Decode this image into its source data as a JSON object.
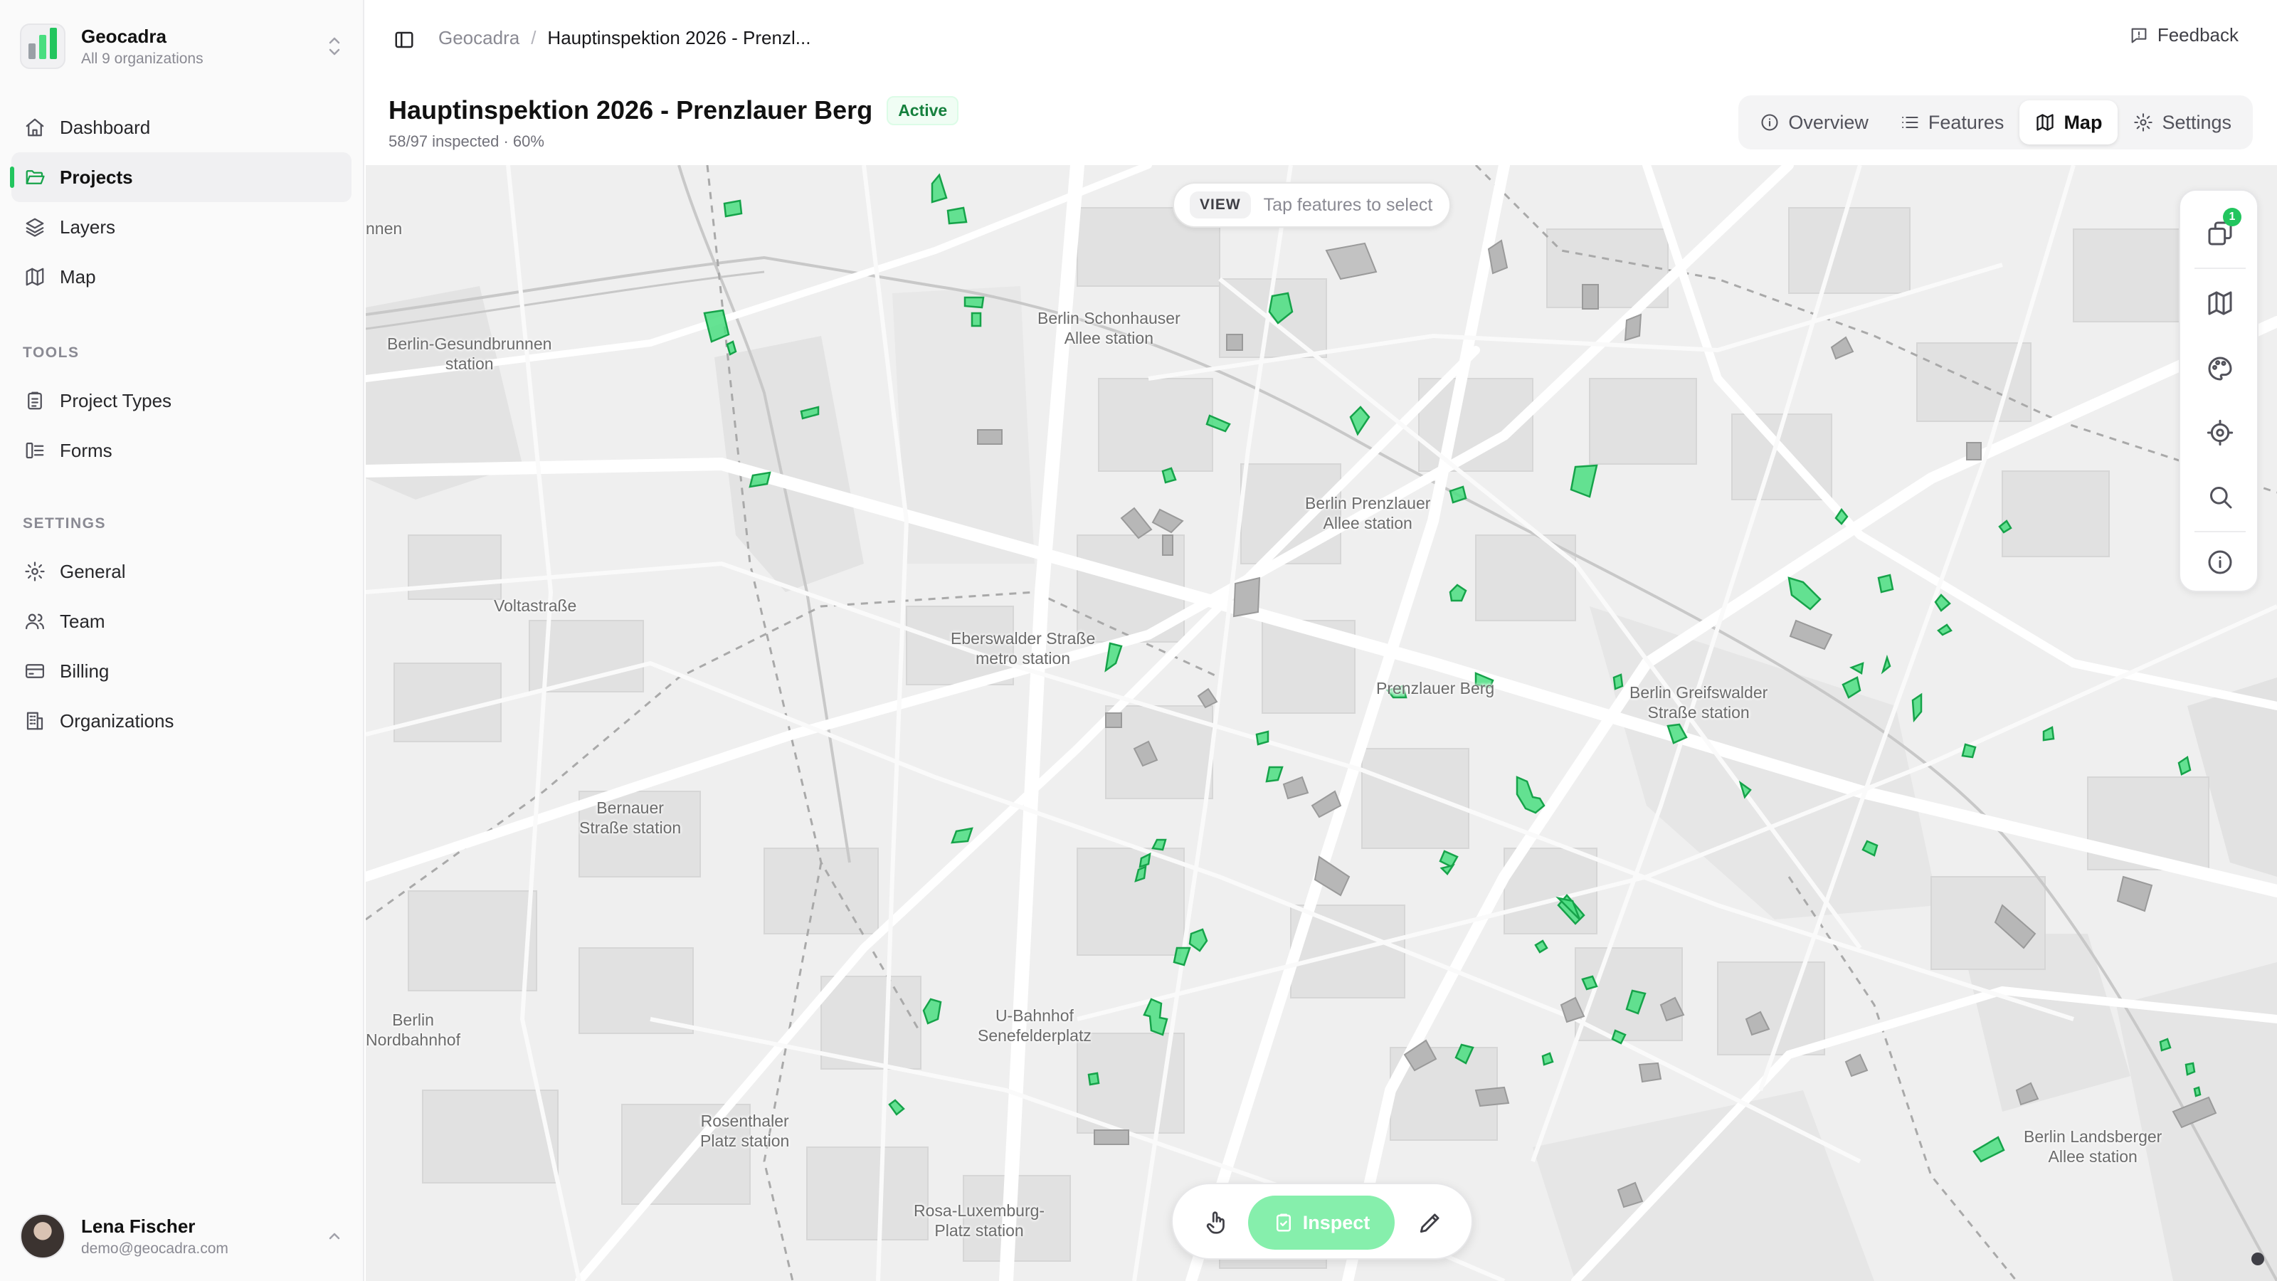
{
  "org": {
    "name": "Geocadra",
    "subtitle": "All 9 organizations"
  },
  "nav": {
    "main": [
      {
        "id": "dashboard",
        "label": "Dashboard",
        "icon": "home-icon"
      },
      {
        "id": "projects",
        "label": "Projects",
        "icon": "folder-open-icon",
        "active": true
      },
      {
        "id": "layers",
        "label": "Layers",
        "icon": "layers-icon"
      },
      {
        "id": "map",
        "label": "Map",
        "icon": "map-icon"
      }
    ],
    "tools_heading": "TOOLS",
    "tools": [
      {
        "id": "project-types",
        "label": "Project Types",
        "icon": "clipboard-list-icon"
      },
      {
        "id": "forms",
        "label": "Forms",
        "icon": "form-input-icon"
      }
    ],
    "settings_heading": "SETTINGS",
    "settings": [
      {
        "id": "general",
        "label": "General",
        "icon": "gear-icon"
      },
      {
        "id": "team",
        "label": "Team",
        "icon": "users-icon"
      },
      {
        "id": "billing",
        "label": "Billing",
        "icon": "credit-card-icon"
      },
      {
        "id": "organizations",
        "label": "Organizations",
        "icon": "building-icon"
      }
    ]
  },
  "user": {
    "name": "Lena Fischer",
    "email": "demo@geocadra.com"
  },
  "breadcrumb": {
    "root": "Geocadra",
    "separator": "/",
    "current": "Hauptinspektion 2026 - Prenzl..."
  },
  "feedback_label": "Feedback",
  "project": {
    "title": "Hauptinspektion 2026 - Prenzlauer Berg",
    "status": "Active",
    "progress_text": "58/97 inspected · 60%"
  },
  "tabs": [
    {
      "id": "overview",
      "label": "Overview",
      "icon": "info-icon"
    },
    {
      "id": "features",
      "label": "Features",
      "icon": "list-icon"
    },
    {
      "id": "map",
      "label": "Map",
      "icon": "map-icon",
      "active": true
    },
    {
      "id": "settings",
      "label": "Settings",
      "icon": "gear-icon"
    }
  ],
  "map": {
    "view_tag": "VIEW",
    "view_hint": "Tap features to select",
    "layers_badge": "1",
    "labels": [
      "nnen",
      "Berlin-Gesundbrunnen\nstation",
      "Berlin Schonhauser\nAllee station",
      "Berlin Prenzlauer\nAllee station",
      "Voltastraße",
      "Eberswalder Straße\nmetro station",
      "Prenzlauer Berg",
      "Berlin Greifswalder\nStraße station",
      "Bernauer\nStraße station",
      "U-Bahnhof\nSenefelderplatz",
      "Berlin\nNordbahnhof",
      "Rosenthaler\nPlatz station",
      "Berlin Landsberger\nAllee station",
      "Rosa-Luxemburg-\nPlatz station"
    ],
    "colors": {
      "feature_fill": "#4ade80",
      "feature_stroke": "#16a34a",
      "building_gray": "#b7b7b7",
      "background": "#efefef"
    }
  },
  "mode_bar": {
    "inspect_label": "Inspect"
  }
}
